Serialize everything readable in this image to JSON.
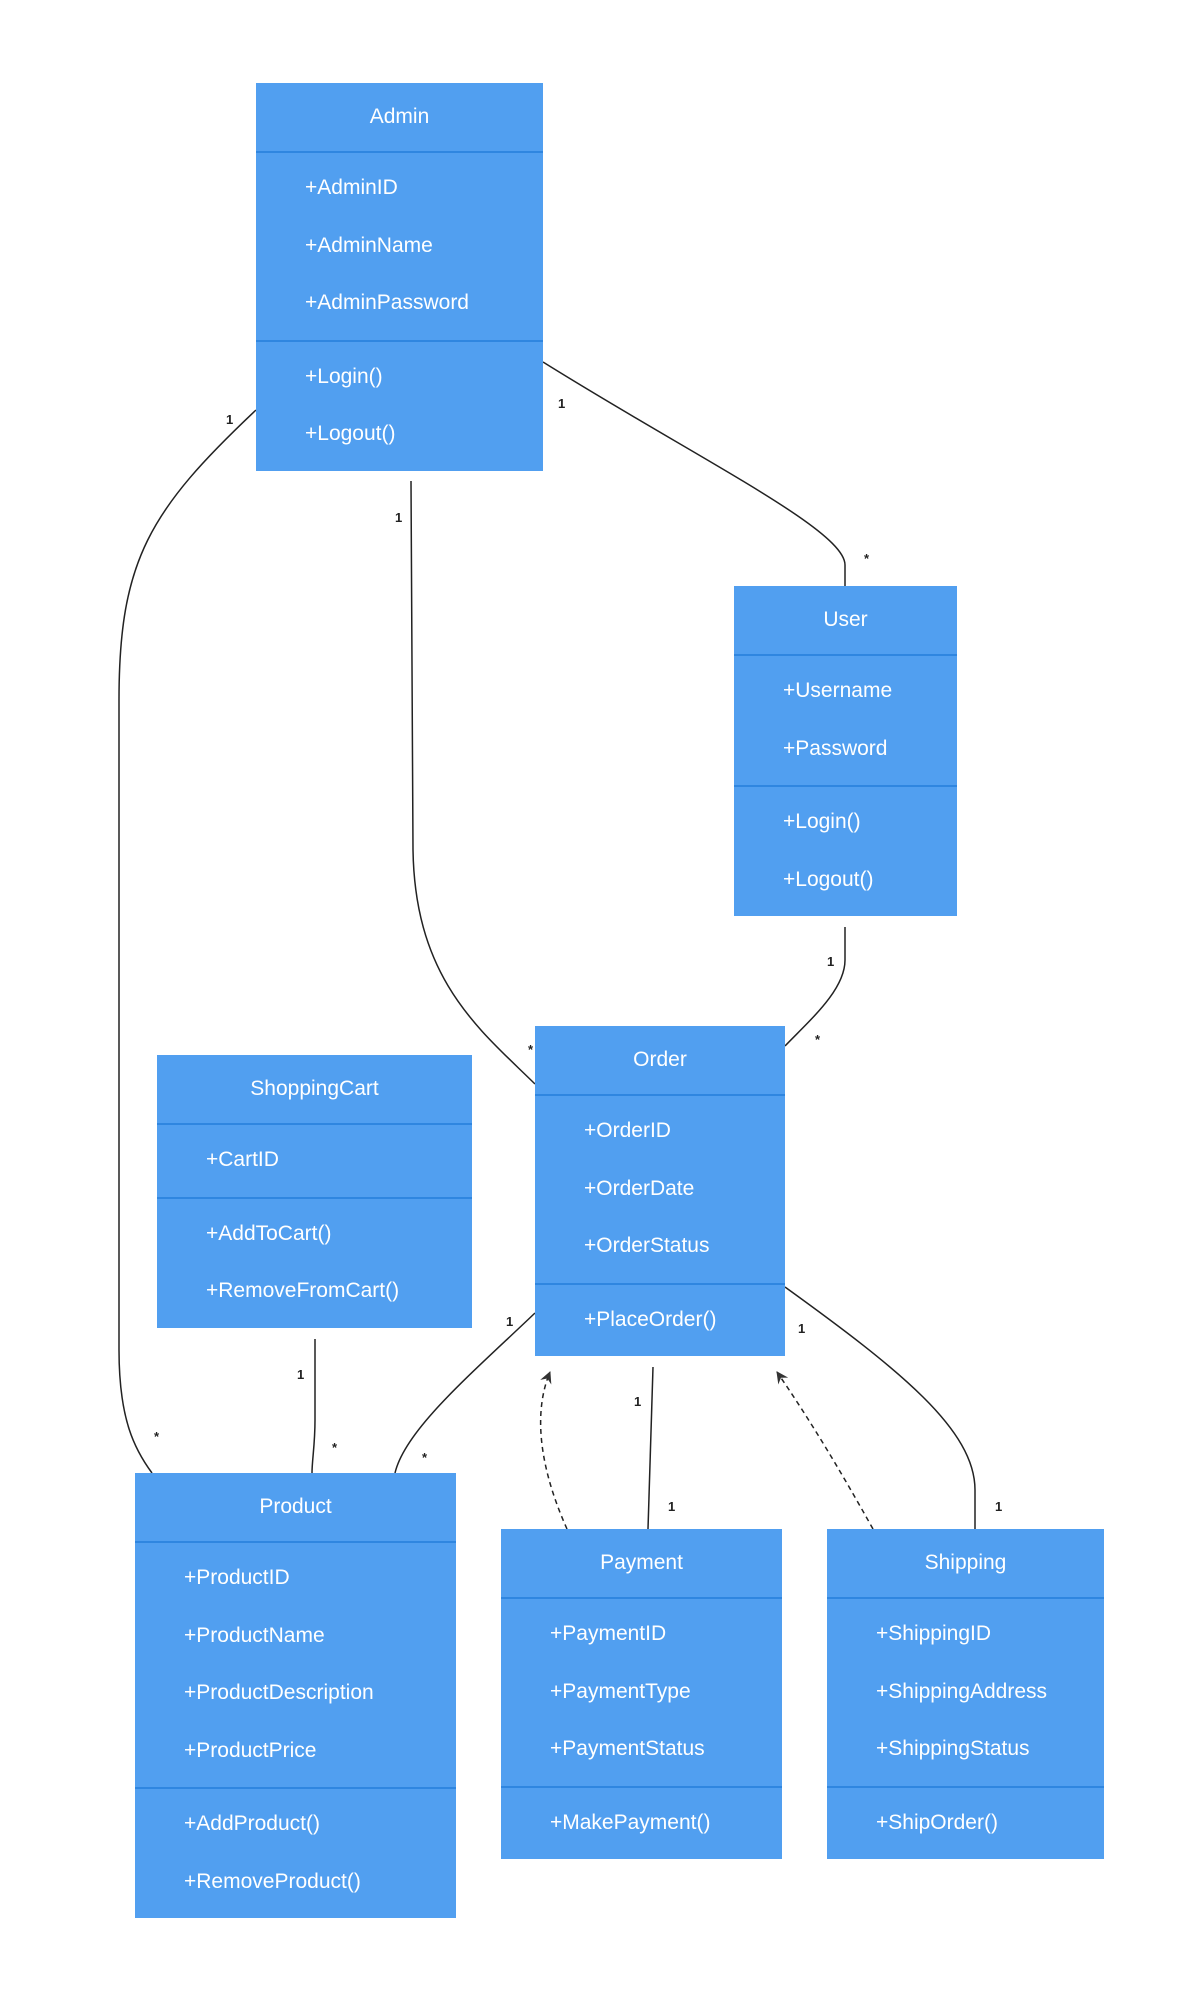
{
  "colors": {
    "class_fill": "#519ff0",
    "class_divider": "#2f86e0",
    "line": "#222222"
  },
  "classes": [
    {
      "id": "admin",
      "name": "Admin",
      "attributes": [
        "+AdminID",
        "+AdminName",
        "+AdminPassword"
      ],
      "methods": [
        "+Login()",
        "+Logout()"
      ]
    },
    {
      "id": "user",
      "name": "User",
      "attributes": [
        "+Username",
        "+Password"
      ],
      "methods": [
        "+Login()",
        "+Logout()"
      ]
    },
    {
      "id": "order",
      "name": "Order",
      "attributes": [
        "+OrderID",
        "+OrderDate",
        "+OrderStatus"
      ],
      "methods": [
        "+PlaceOrder()"
      ]
    },
    {
      "id": "shoppingcart",
      "name": "ShoppingCart",
      "attributes": [
        "+CartID"
      ],
      "methods": [
        "+AddToCart()",
        "+RemoveFromCart()"
      ]
    },
    {
      "id": "product",
      "name": "Product",
      "attributes": [
        "+ProductID",
        "+ProductName",
        "+ProductDescription",
        "+ProductPrice"
      ],
      "methods": [
        "+AddProduct()",
        "+RemoveProduct()"
      ]
    },
    {
      "id": "payment",
      "name": "Payment",
      "attributes": [
        "+PaymentID",
        "+PaymentType",
        "+PaymentStatus"
      ],
      "methods": [
        "+MakePayment()"
      ]
    },
    {
      "id": "shipping",
      "name": "Shipping",
      "attributes": [
        "+ShippingID",
        "+ShippingAddress",
        "+ShippingStatus"
      ],
      "methods": [
        "+ShipOrder()"
      ]
    }
  ],
  "relationships": [
    {
      "from": "Admin",
      "to": "Product",
      "type": "association",
      "from_mult": "1",
      "to_mult": "*"
    },
    {
      "from": "Admin",
      "to": "Order",
      "type": "association",
      "from_mult": "1",
      "to_mult": "*"
    },
    {
      "from": "Admin",
      "to": "User",
      "type": "association",
      "from_mult": "1",
      "to_mult": "*"
    },
    {
      "from": "User",
      "to": "Order",
      "type": "association",
      "from_mult": "1",
      "to_mult": "*"
    },
    {
      "from": "ShoppingCart",
      "to": "Product",
      "type": "association",
      "from_mult": "1",
      "to_mult": "*"
    },
    {
      "from": "Order",
      "to": "Product",
      "type": "association",
      "from_mult": "1",
      "to_mult": "*"
    },
    {
      "from": "Order",
      "to": "Payment",
      "type": "association",
      "from_mult": "1",
      "to_mult": "1"
    },
    {
      "from": "Order",
      "to": "Shipping",
      "type": "association",
      "from_mult": "1",
      "to_mult": "1"
    },
    {
      "from": "Payment",
      "to": "Order",
      "type": "dependency",
      "from_mult": "",
      "to_mult": ""
    },
    {
      "from": "Shipping",
      "to": "Order",
      "type": "dependency",
      "from_mult": "",
      "to_mult": ""
    }
  ]
}
